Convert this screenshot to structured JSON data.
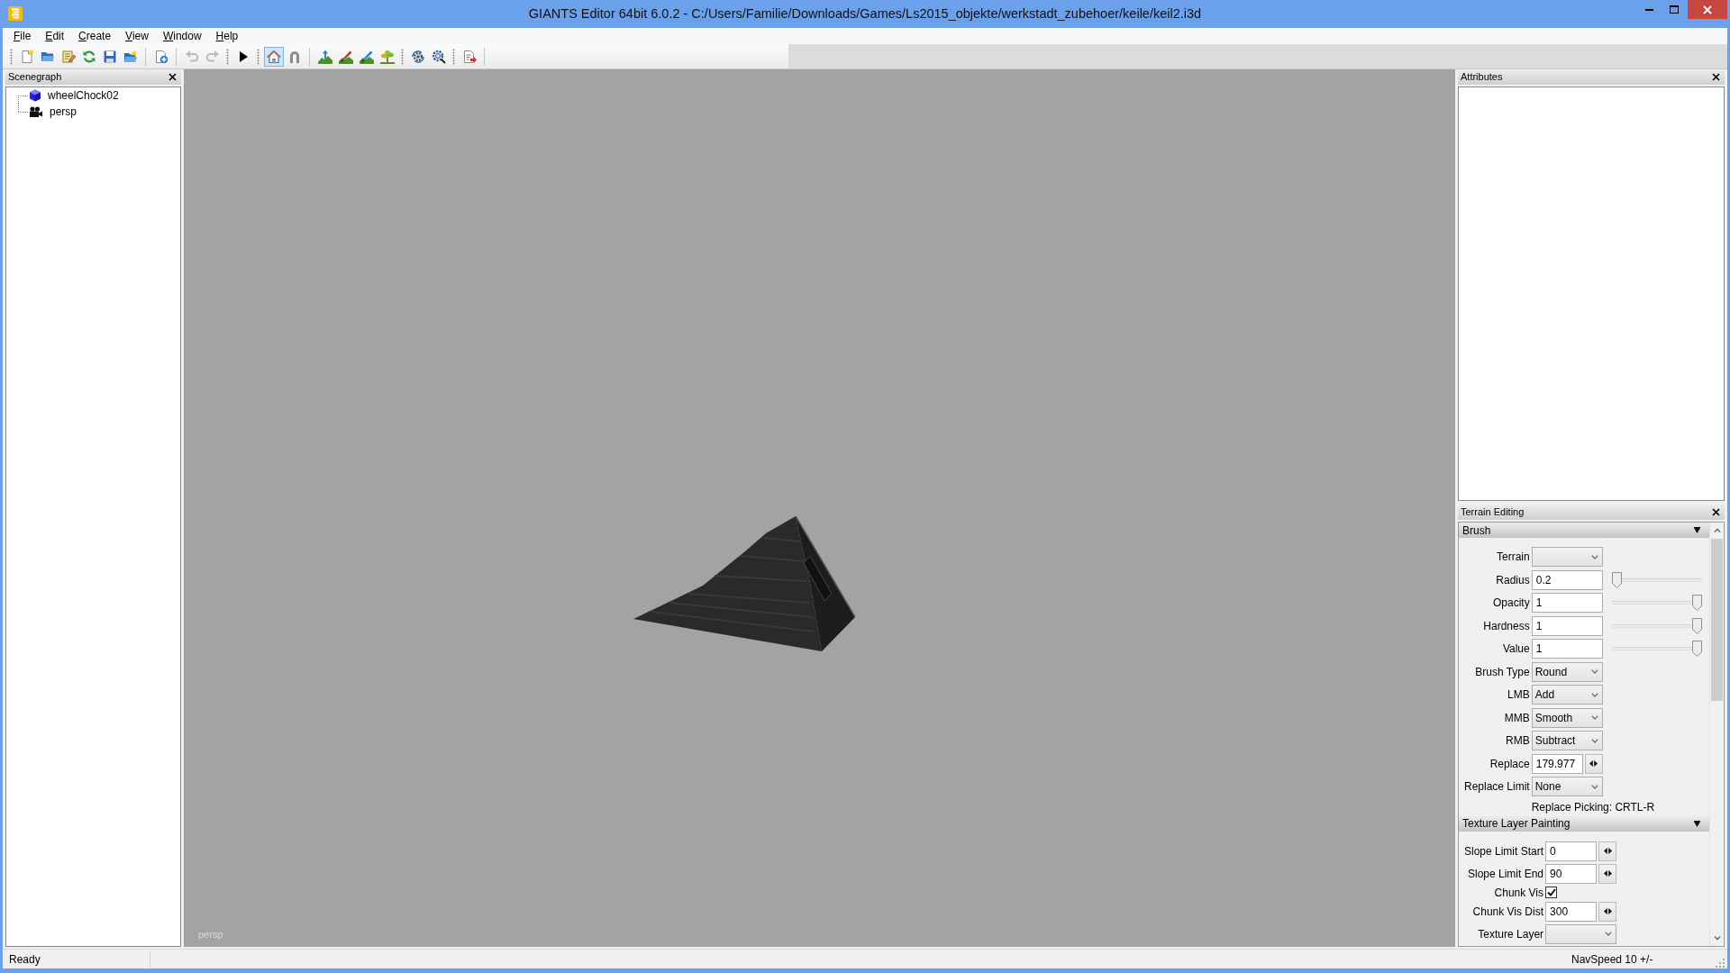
{
  "window": {
    "title": "GIANTS Editor 64bit 6.0.2 - C:/Users/Familie/Downloads/Games/Ls2015_objekte/werkstadt_zubehoer/keile/keil2.i3d"
  },
  "menu": [
    {
      "label": "File"
    },
    {
      "label": "Edit"
    },
    {
      "label": "Create"
    },
    {
      "label": "View"
    },
    {
      "label": "Window"
    },
    {
      "label": "Help"
    }
  ],
  "toolbar": {
    "groups": [
      {
        "buttons": [
          {
            "pressed": false,
            "disabled": false
          },
          {
            "pressed": false,
            "disabled": false
          },
          {
            "pressed": false,
            "disabled": false
          },
          {
            "pressed": false,
            "disabled": false
          },
          {
            "pressed": false,
            "disabled": false
          },
          {
            "pressed": false,
            "disabled": false
          }
        ]
      },
      {
        "buttons": [
          {
            "pressed": false,
            "disabled": false
          }
        ]
      },
      {
        "buttons": [
          {
            "pressed": false,
            "disabled": true
          },
          {
            "pressed": false,
            "disabled": true
          }
        ]
      },
      {
        "buttons": [
          {
            "pressed": false,
            "disabled": false
          }
        ]
      },
      {
        "buttons": [
          {
            "pressed": true,
            "disabled": false
          },
          {
            "pressed": false,
            "disabled": false
          }
        ]
      },
      {
        "buttons": [
          {
            "pressed": false,
            "disabled": false
          },
          {
            "pressed": false,
            "disabled": false
          },
          {
            "pressed": false,
            "disabled": false
          },
          {
            "pressed": false,
            "disabled": false
          }
        ]
      },
      {
        "buttons": [
          {
            "pressed": false,
            "disabled": false
          },
          {
            "pressed": false,
            "disabled": false
          }
        ]
      },
      {
        "buttons": [
          {
            "pressed": false,
            "disabled": false
          }
        ]
      }
    ]
  },
  "scenegraph": {
    "title": "Scenegraph",
    "items": [
      {
        "label": "wheelChock02",
        "kind": "mesh",
        "selected": false
      },
      {
        "label": "persp",
        "kind": "camera",
        "selected": false
      }
    ]
  },
  "viewport": {
    "camera": "persp"
  },
  "attributes": {
    "title": "Attributes"
  },
  "terrain_editing": {
    "title": "Terrain Editing",
    "sections": [
      {
        "title": "Brush",
        "expanded": true,
        "rows": [
          {
            "kind": "select",
            "label": "Terrain"
          },
          {
            "kind": "slider",
            "label": "Radius",
            "value": "0.2",
            "level": 0
          },
          {
            "kind": "slider",
            "label": "Opacity",
            "value": "1",
            "level": 1
          },
          {
            "kind": "slider",
            "label": "Hardness",
            "value": "1",
            "level": 1
          },
          {
            "kind": "slider",
            "label": "Value",
            "value": "1",
            "level": 1
          },
          {
            "kind": "select",
            "label": "Brush Type",
            "value": "Round"
          },
          {
            "kind": "select",
            "label": "LMB",
            "value": "Add"
          },
          {
            "kind": "select",
            "label": "MMB",
            "value": "Smooth"
          },
          {
            "kind": "select",
            "label": "RMB",
            "value": "Subtract"
          },
          {
            "kind": "spin",
            "label": "Replace",
            "value": "179.977"
          },
          {
            "kind": "select",
            "label": "Replace Limit",
            "value": "None"
          },
          {
            "kind": "note",
            "text": "Replace Picking: CRTL-R"
          }
        ]
      },
      {
        "title": "Texture Layer Painting",
        "expanded": true,
        "rows": [
          {
            "kind": "spin",
            "label": "Slope Limit Start",
            "value": "0"
          },
          {
            "kind": "spin",
            "label": "Slope Limit End",
            "value": "90"
          },
          {
            "kind": "checkbox",
            "label": "Chunk Vis",
            "checked": true
          },
          {
            "kind": "spin",
            "label": "Chunk Vis Dist",
            "value": "300"
          },
          {
            "kind": "select",
            "label": "Texture Layer"
          }
        ]
      }
    ]
  },
  "status_bar": {
    "message": "Ready",
    "nav_speed": "NavSpeed 10 +/-"
  }
}
